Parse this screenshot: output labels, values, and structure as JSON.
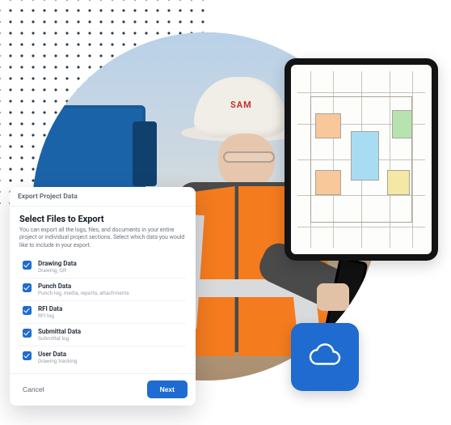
{
  "helmet_label": "SAM",
  "cloud_tile": {
    "color": "#1f6bd0"
  },
  "export_dialog": {
    "header": "Export Project Data",
    "title": "Select Files to Export",
    "subtitle": "You can export all the logs, files, and documents in your entire project or individual project sections. Select which data you would like to include in your export.",
    "options": [
      {
        "label": "Drawing Data",
        "desc": "Drawing, QR"
      },
      {
        "label": "Punch Data",
        "desc": "Punch log, media, reports, attachments"
      },
      {
        "label": "RFI Data",
        "desc": "RFI log"
      },
      {
        "label": "Submittal Data",
        "desc": "Submittal log"
      },
      {
        "label": "User Data",
        "desc": "Drawing tracking"
      }
    ],
    "cancel": "Cancel",
    "next": "Next"
  }
}
